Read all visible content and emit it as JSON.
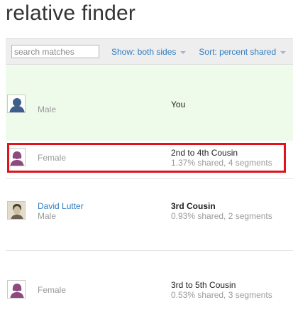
{
  "page": {
    "title": "relative finder"
  },
  "toolbar": {
    "search_placeholder": "search matches",
    "show_label": "Show: both sides",
    "sort_label": "Sort: percent shared"
  },
  "matches": [
    {
      "name": "",
      "gender": "Male",
      "relationship": "You",
      "stats": "",
      "avatar": "male-silhouette-icon",
      "highlighted": false
    },
    {
      "name": "",
      "gender": "Female",
      "relationship": "2nd to 4th Cousin",
      "stats": "1.37% shared, 4 segments",
      "avatar": "female-silhouette-icon",
      "highlighted": true
    },
    {
      "name": "David Lutter",
      "gender": "Male",
      "relationship": "3rd Cousin",
      "stats": "0.93% shared, 2 segments",
      "avatar": "profile-photo",
      "highlighted": false
    },
    {
      "name": "",
      "gender": "Female",
      "relationship": "3rd to 5th Cousin",
      "stats": "0.53% shared, 3 segments",
      "avatar": "female-silhouette-icon",
      "highlighted": false
    }
  ],
  "colors": {
    "link": "#2f7bbf",
    "you_row_bg": "#eefbea",
    "highlight_border": "#e0121b",
    "male_avatar": "#3e5f8a",
    "female_avatar": "#8d4a7e"
  }
}
